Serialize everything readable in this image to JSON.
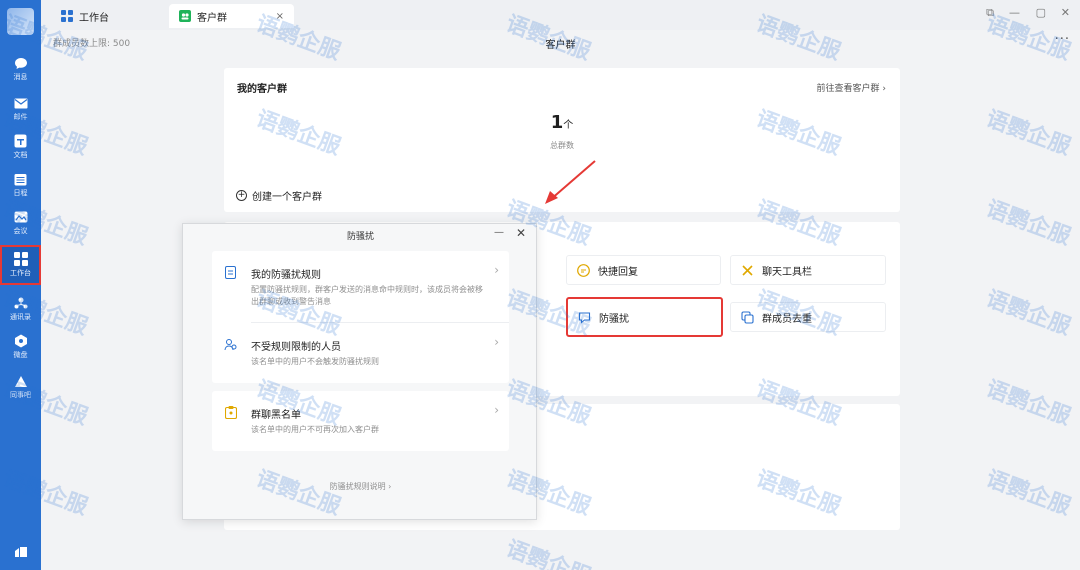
{
  "sidebar": {
    "items": [
      {
        "label": "消息",
        "icon": "chat-bubble-icon"
      },
      {
        "label": "邮件",
        "icon": "mail-icon"
      },
      {
        "label": "文档",
        "icon": "document-icon"
      },
      {
        "label": "日程",
        "icon": "calendar-icon"
      },
      {
        "label": "会议",
        "icon": "meeting-icon"
      },
      {
        "label": "工作台",
        "icon": "grid-icon"
      },
      {
        "label": "通讯录",
        "icon": "contacts-icon"
      },
      {
        "label": "微盘",
        "icon": "disk-icon"
      },
      {
        "label": "同事吧",
        "icon": "community-icon"
      }
    ]
  },
  "tabs": [
    {
      "label": "工作台",
      "icon": "grid-icon"
    },
    {
      "label": "客户群",
      "icon": "customer-group-icon",
      "close": "×"
    }
  ],
  "window_controls": {
    "snap": "⧉",
    "minimize": "—",
    "maximize": "▢",
    "close": "✕"
  },
  "header": {
    "limit_text": "群成员数上限: 500",
    "title": "客户群",
    "more": "···"
  },
  "groups_card": {
    "title": "我的客户群",
    "link": "前往查看客户群 ›",
    "count_value": "1",
    "count_unit": "个",
    "count_label": "总群数",
    "create_label": "创建一个客户群",
    "create_icon": "+"
  },
  "tools": [
    {
      "label": "快捷回复",
      "icon": "quick-reply-icon"
    },
    {
      "label": "聊天工具栏",
      "icon": "toolbar-icon"
    },
    {
      "label": "防骚扰",
      "icon": "anti-harass-icon"
    },
    {
      "label": "群成员去重",
      "icon": "dedupe-icon"
    }
  ],
  "modal": {
    "title": "防骚扰",
    "minimize": "—",
    "close": "✕",
    "options": [
      {
        "title": "我的防骚扰规则",
        "desc": "配置防骚扰规则，群客户发送的消息命中规则时，该成员将会被移出群聊或收到警告消息",
        "icon": "rule-doc-icon",
        "chevron": "›"
      },
      {
        "title": "不受规则限制的人员",
        "desc": "该名单中的用户不会触发防骚扰规则",
        "icon": "people-icon",
        "chevron": "›"
      },
      {
        "title": "群聊黑名单",
        "desc": "该名单中的用户不可再次加入客户群",
        "icon": "blacklist-icon",
        "chevron": "›"
      }
    ],
    "footer": "防骚扰规则说明 ›"
  },
  "watermark": "语鹦企服",
  "colors": {
    "sidebar": "#2a71d0",
    "highlight": "#e53935",
    "watermark": "#2a71d0"
  }
}
